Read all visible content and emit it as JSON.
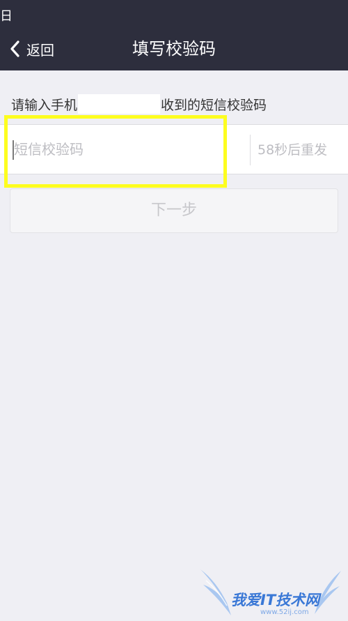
{
  "status_bar": {
    "fragment": "日"
  },
  "nav": {
    "back_label": "返回",
    "title": "填写校验码"
  },
  "instruction": {
    "prefix": "请输入手机",
    "suffix": "收到的短信校验码"
  },
  "code_input": {
    "placeholder": "短信校验码",
    "value": ""
  },
  "resend": {
    "label": "58秒后重发"
  },
  "next_button": {
    "label": "下一步"
  },
  "watermark": {
    "text": "我爱IT技术网",
    "url": "www.52ij.com"
  },
  "colors": {
    "nav_background": "#2d2e3d",
    "page_background": "#efeff4",
    "highlight": "#fdfd1f",
    "watermark": "#3a78d6"
  },
  "icons": {
    "back": "chevron-left-icon",
    "watermark": "wings-logo"
  }
}
